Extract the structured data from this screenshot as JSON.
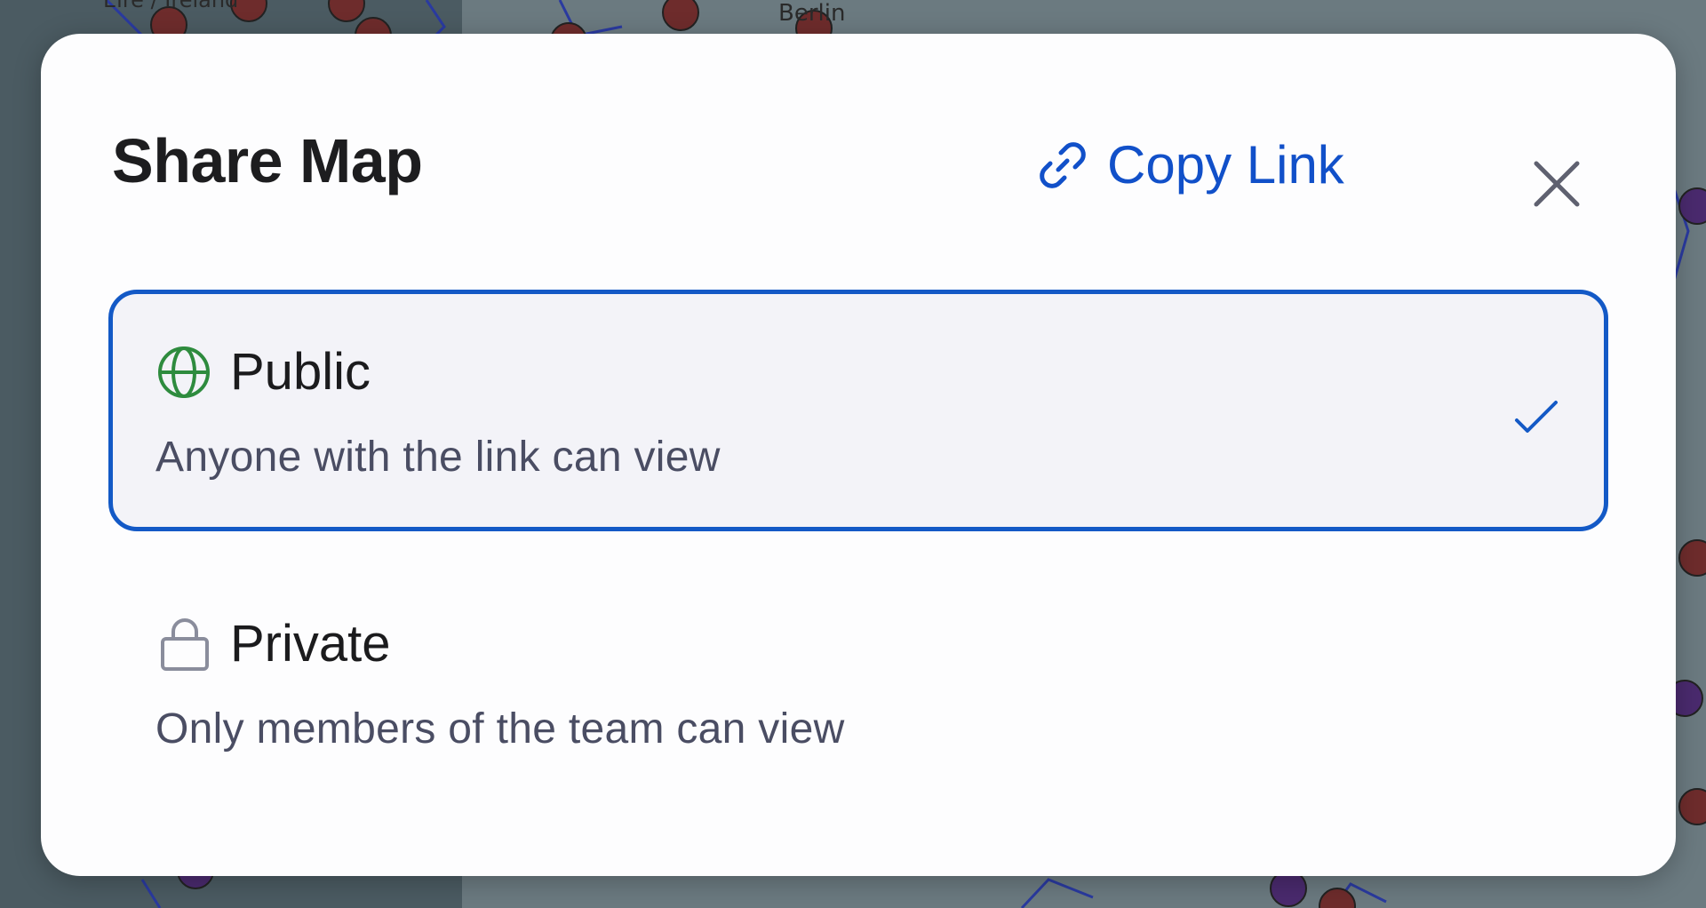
{
  "background": {
    "map_labels": [
      "Berlin",
      "Éire / Ireland"
    ]
  },
  "dialog": {
    "title": "Share Map",
    "copy_link_label": "Copy Link",
    "copy_link_icon": "link-icon",
    "close_icon": "close-icon",
    "accent_color": "#1150c9",
    "options": [
      {
        "label": "Public",
        "description": "Anyone with the link can view",
        "icon": "globe-icon",
        "icon_color": "#2e8b3e",
        "selected": true
      },
      {
        "label": "Private",
        "description": "Only members of the team can view",
        "icon": "lock-icon",
        "icon_color": "#8a8d9c",
        "selected": false
      }
    ],
    "selected_check_icon": "checkmark-icon"
  }
}
